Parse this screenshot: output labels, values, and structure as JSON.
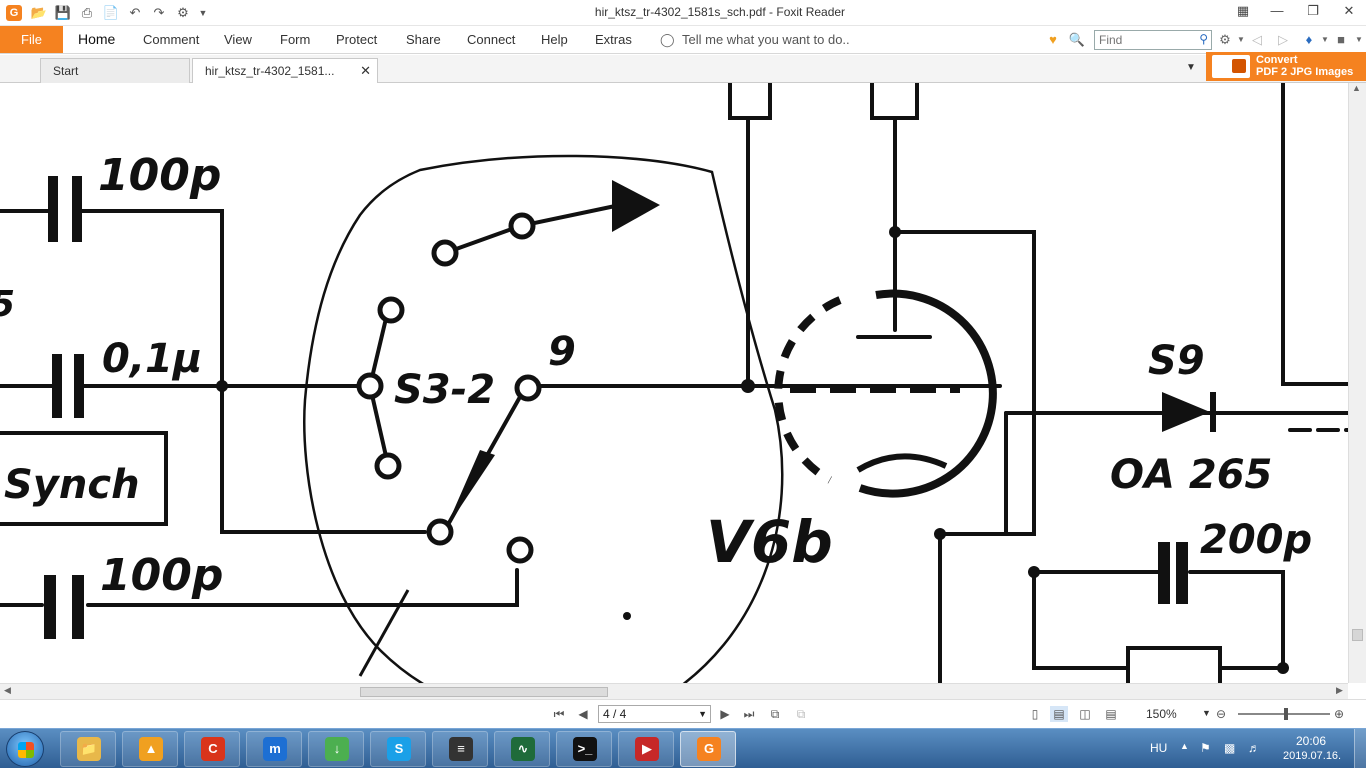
{
  "window": {
    "title": "hir_ktsz_tr-4302_1581s_sch.pdf - Foxit Reader",
    "app_icon_letter": "G",
    "quick_access": [
      "folder-open-icon",
      "save-icon",
      "print-icon",
      "new-icon",
      "undo-icon",
      "redo-icon",
      "customize-icon"
    ],
    "controls": [
      "restore-toolbar-icon",
      "minimize-icon",
      "maximize-icon",
      "close-icon"
    ]
  },
  "ribbon": {
    "file_label": "File",
    "tabs": [
      "Home",
      "Comment",
      "View",
      "Form",
      "Protect",
      "Share",
      "Connect",
      "Help",
      "Extras"
    ],
    "active_tab": "Home",
    "tell_me": "Tell me what you want to do..",
    "find_placeholder": "Find"
  },
  "doc_tabs": [
    {
      "label": "Start"
    },
    {
      "label": "hir_ktsz_tr-4302_1581..."
    }
  ],
  "convert": {
    "line1": "Convert",
    "line2": "PDF 2 JPG Images"
  },
  "schematic": {
    "labels": {
      "c1": "100p",
      "c2": "0,1μ",
      "c3": "100p",
      "switch": "S3-2",
      "pin": "9",
      "synch": "Synch",
      "tube": "V6b",
      "diode_ref": "S9",
      "diode": "OA 265",
      "c4": "200p",
      "left_edge": "5"
    },
    "colors": {
      "ink": "#111111",
      "paper": "#ffffff"
    }
  },
  "statusbar": {
    "page_value": "4 / 4",
    "zoom_value": "150%"
  },
  "taskbar": {
    "apps": [
      {
        "name": "explorer",
        "glyph": "📁",
        "color": "#e8b84a"
      },
      {
        "name": "aimp",
        "glyph": "▲",
        "color": "#f0a020"
      },
      {
        "name": "ccleaner",
        "glyph": "C",
        "color": "#d9341a"
      },
      {
        "name": "maxthon",
        "glyph": "m",
        "color": "#1d6fd3"
      },
      {
        "name": "uget",
        "glyph": "↓",
        "color": "#4caf50"
      },
      {
        "name": "skype",
        "glyph": "S",
        "color": "#1aa0e8"
      },
      {
        "name": "network",
        "glyph": "≡",
        "color": "#333"
      },
      {
        "name": "monitor",
        "glyph": "∿",
        "color": "#1f6b3a"
      },
      {
        "name": "cmd",
        "glyph": ">_",
        "color": "#111"
      },
      {
        "name": "video",
        "glyph": "▶",
        "color": "#c62828"
      },
      {
        "name": "foxit",
        "glyph": "G",
        "color": "#f58220"
      }
    ],
    "language": "HU",
    "time": "20:06",
    "date": "2019.07.16."
  }
}
